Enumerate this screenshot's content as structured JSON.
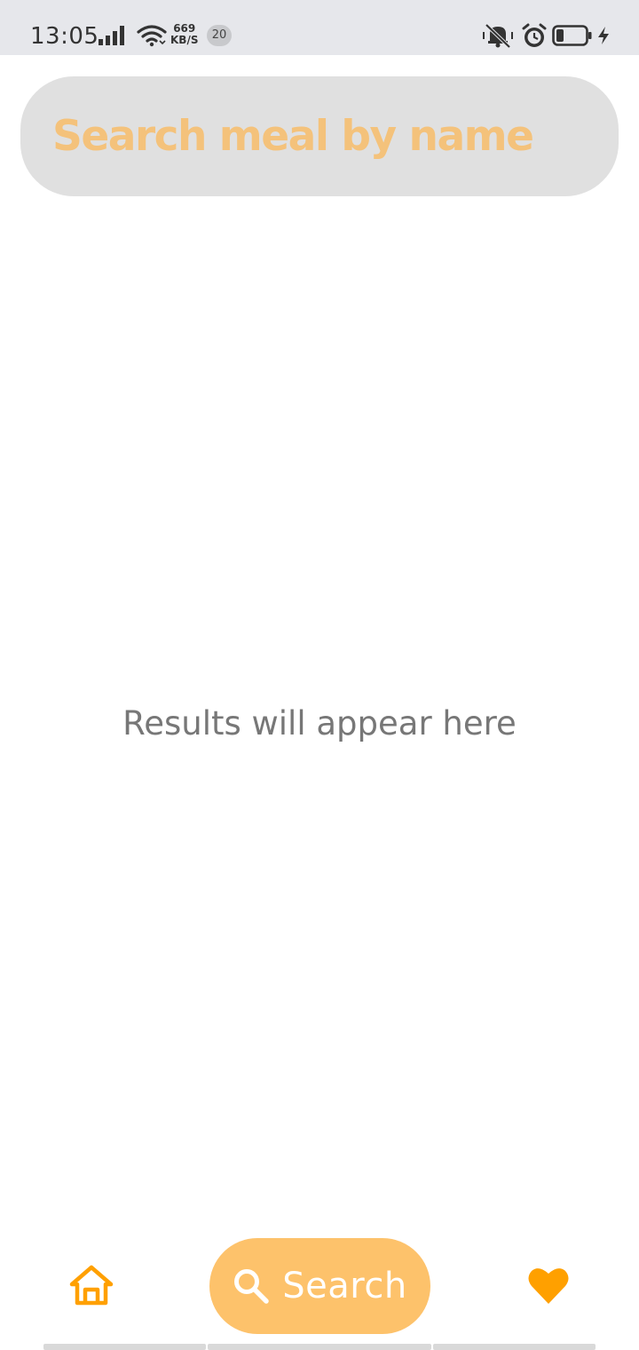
{
  "status_bar": {
    "time": "13:05",
    "speed_value": "669",
    "speed_unit": "KB/S",
    "notification_count": "20",
    "icons": [
      "signal-icon",
      "wifi-icon",
      "mute-icon",
      "alarm-icon",
      "battery-icon",
      "charging-icon"
    ]
  },
  "search": {
    "placeholder": "Search meal by name",
    "value": ""
  },
  "results": {
    "empty_text": "Results will appear here"
  },
  "bottom_nav": {
    "items": [
      {
        "id": "home",
        "icon": "home-icon"
      },
      {
        "id": "search",
        "icon": "search-icon",
        "label": "Search",
        "active": true
      },
      {
        "id": "favorites",
        "icon": "heart-icon"
      }
    ]
  },
  "colors": {
    "accent": "#fdc26b",
    "accent_text": "#f4c27b",
    "icon_orange": "#ffa000",
    "search_bg": "#e0e0e0",
    "status_bg": "#e6e7eb",
    "muted_text": "#777777"
  }
}
